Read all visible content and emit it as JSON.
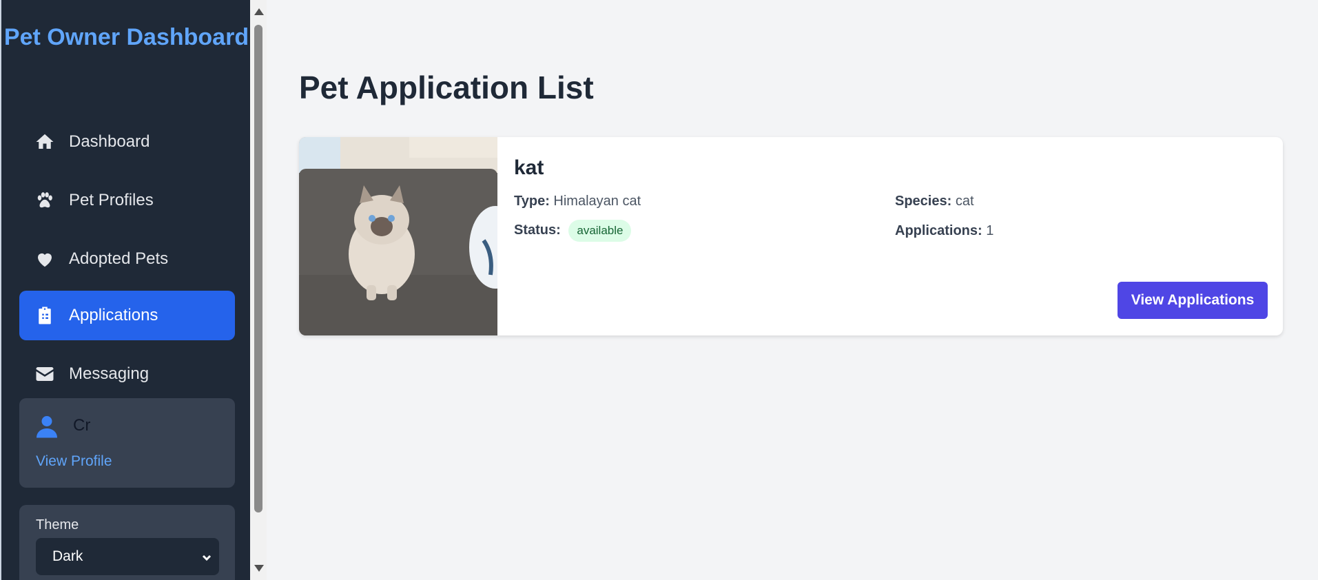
{
  "sidebar": {
    "brand": "Pet Owner Dashboard",
    "items": [
      {
        "label": "Dashboard",
        "icon": "home-icon"
      },
      {
        "label": "Pet Profiles",
        "icon": "paw-icon"
      },
      {
        "label": "Adopted Pets",
        "icon": "heart-icon"
      },
      {
        "label": "Applications",
        "icon": "clipboard-list-icon",
        "active": true
      },
      {
        "label": "Messaging",
        "icon": "envelope-icon"
      }
    ],
    "user": {
      "name": "Cr",
      "view_profile_label": "View Profile"
    },
    "theme": {
      "label": "Theme",
      "selected": "Dark"
    }
  },
  "main": {
    "title": "Pet Application List",
    "pets": [
      {
        "name": "kat",
        "type_label": "Type:",
        "type": "Himalayan cat",
        "species_label": "Species:",
        "species": "cat",
        "status_label": "Status:",
        "status": "available",
        "applications_label": "Applications:",
        "applications": "1",
        "button_label": "View Applications"
      }
    ]
  },
  "colors": {
    "sidebar_bg": "#1f2937",
    "brand": "#60a5fa",
    "active_nav": "#2563eb",
    "primary_button": "#4f46e5",
    "status_available_bg": "#dcfce7",
    "status_available_text": "#166534"
  }
}
